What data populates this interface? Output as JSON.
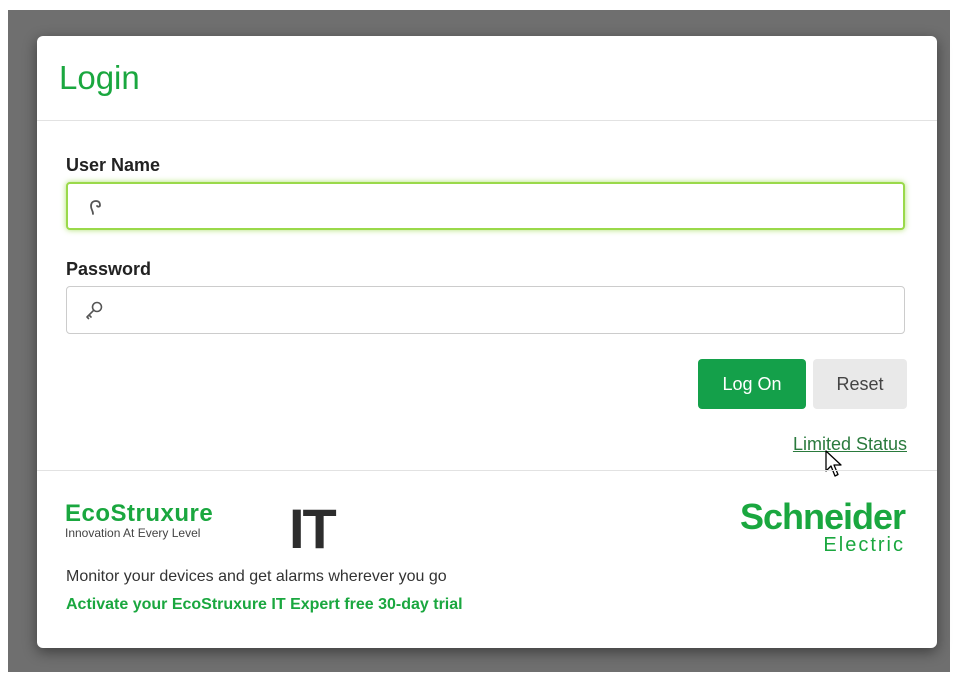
{
  "modal": {
    "title": "Login"
  },
  "form": {
    "username_label": "User Name",
    "username_value": "",
    "password_label": "Password",
    "password_value": "",
    "logon_label": "Log On",
    "reset_label": "Reset",
    "limited_status_label": "Limited Status"
  },
  "footer": {
    "eco_logo_text": "EcoStruxure",
    "eco_tagline": "Innovation At Every Level",
    "eco_suffix": "IT",
    "schneider_name": "Schneider",
    "schneider_sub": "Electric",
    "monitor_text": "Monitor your devices and get alarms wherever you go",
    "trial_link": "Activate your EcoStruxure IT Expert free 30-day trial"
  },
  "icons": {
    "username": "user-icon",
    "password": "key-icon"
  },
  "colors": {
    "brand_green": "#1aa73f",
    "button_green": "#14a04a",
    "focus_glow": "#9ad94a",
    "backdrop": "#6f6f6f"
  }
}
